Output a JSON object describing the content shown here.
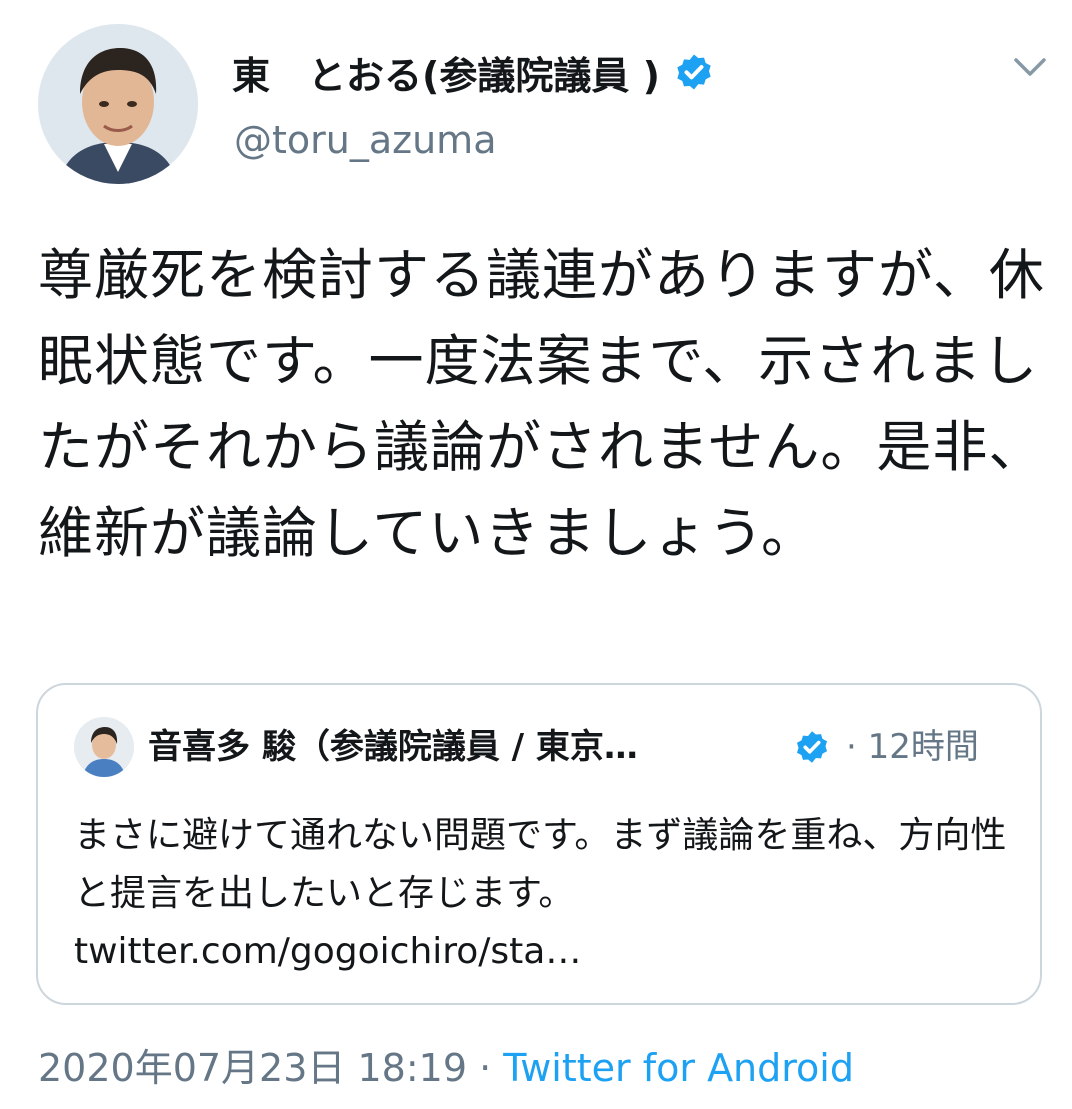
{
  "author": {
    "display_name": "東　とおる(参議院議員 )",
    "handle": "@toru_azuma",
    "verified": true,
    "avatar_icon": "profile-photo"
  },
  "tweet": {
    "text": "尊厳死を検討する議連がありますが、休眠状態です。一度法案まで、示されましたがそれから議論がされません。是非、維新が議論していきましょう。",
    "date": "2020年07月23日 18:19",
    "separator": "·",
    "source": "Twitter for Android"
  },
  "quoted_tweet": {
    "display_name": "音喜多 駿（参議院議員 / 東京…",
    "verified": true,
    "time_separator": "·",
    "time": "12時間",
    "text": "まさに避けて通れない問題です。まず議論を重ね、方向性と提言を出したいと存じます。",
    "link": "twitter.com/gogoichiro/sta…"
  },
  "colors": {
    "accent": "#1da1f2",
    "secondary_text": "#657786",
    "border": "#ccd6dd"
  },
  "icons": {
    "verified": "verified-badge-icon",
    "menu": "chevron-down-icon"
  }
}
